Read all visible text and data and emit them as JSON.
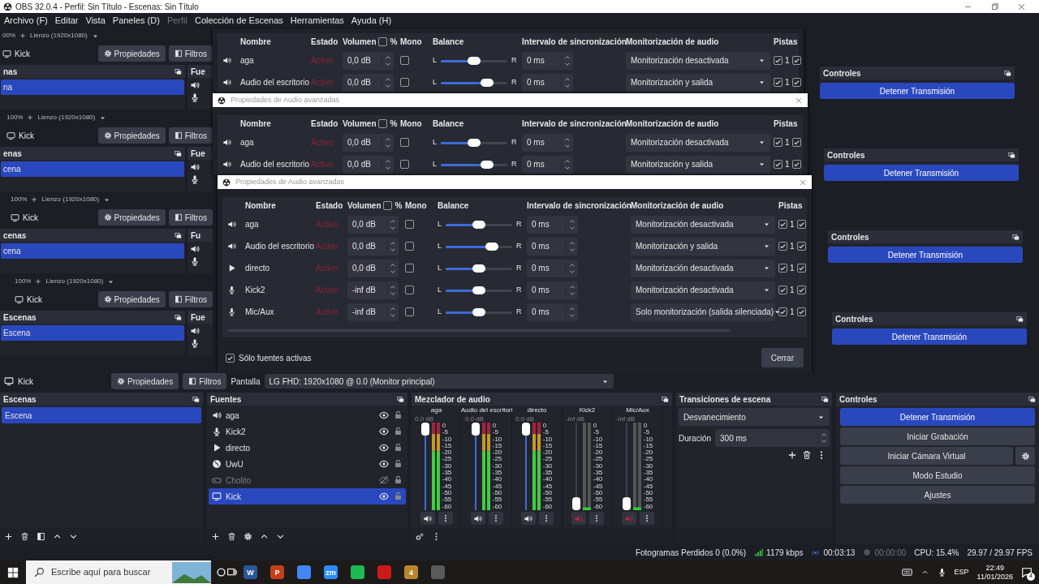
{
  "window": {
    "title": "OBS 32.0.4 - Perfil: Sin Título - Escenas: Sin Título"
  },
  "menu": [
    {
      "label": "Archivo (F)",
      "disabled": false
    },
    {
      "label": "Editar",
      "disabled": false
    },
    {
      "label": "Vista",
      "disabled": false
    },
    {
      "label": "Paneles (D)",
      "disabled": false
    },
    {
      "label": "Perfil",
      "disabled": true
    },
    {
      "label": "Colección de Escenas",
      "disabled": false
    },
    {
      "label": "Herramientas",
      "disabled": false
    },
    {
      "label": "Ayuda (H)",
      "disabled": false
    }
  ],
  "preview_layers": [
    {
      "zoom": "00%",
      "canvas": "Lienzo (1920x1080)",
      "source": "Kick",
      "properties": "Propiedades",
      "filters": "Filtros",
      "scenes_title": "nas",
      "sources_title": "Fue",
      "scene": "na",
      "controls_title": "Controles",
      "stream_button": "Detener Transmisión"
    },
    {
      "zoom": "100%",
      "canvas": "Lienzo (1920x1080)",
      "source": "Kick",
      "properties": "Propiedades",
      "filters": "Filtros",
      "scenes_title": "enas",
      "sources_title": "Fue",
      "scene": "cena",
      "controls_title": "Controles",
      "stream_button": "Detener Transmisión"
    },
    {
      "zoom": "100%",
      "canvas": "Lienzo (1920x1080)",
      "source": "Kick",
      "properties": "Propiedades",
      "filters": "Filtros",
      "scenes_title": "cenas",
      "sources_title": "Fu",
      "scene": "cena",
      "controls_title": "Controles",
      "stream_button": "Detener Transmisión"
    },
    {
      "zoom": "100%",
      "canvas": "Lienzo (1920x1080)",
      "source": "Kick",
      "properties": "Propiedades",
      "filters": "Filtros",
      "scenes_title": "Escenas",
      "sources_title": "Fue",
      "scene": "Escena",
      "controls_title": "Controles",
      "stream_button": "Detener Transmisión"
    }
  ],
  "dialogs": [
    {
      "columns": {
        "name": "Nombre",
        "status": "Estado",
        "volume": "Volumen",
        "percent": {
          "label": "%",
          "checked": false
        },
        "mono": "Mono",
        "balance": "Balance",
        "sync": "Intervalo de sincronización",
        "monitoring": "Monitorización de audio",
        "tracks": "Pistas"
      },
      "rows": [
        {
          "kind": "speaker",
          "name": "aga",
          "status": "Activo",
          "volume": "0,0 dB",
          "mono": false,
          "balance": {
            "left": "L",
            "right": "R",
            "level": 0.5
          },
          "sync": "0 ms",
          "monitoring": "Monitorización desactivada",
          "tracks": [
            {
              "label": "1",
              "checked": true
            },
            {
              "checked": true
            }
          ]
        },
        {
          "kind": "speaker",
          "name": "Audio del escritorio",
          "status": "Activo",
          "volume": "0,0 dB",
          "mono": false,
          "balance": {
            "left": "L",
            "right": "R",
            "level": 0.7
          },
          "sync": "0 ms",
          "monitoring": "Monitorización y salida",
          "tracks": [
            {
              "label": "1",
              "checked": true
            },
            {
              "checked": true
            }
          ]
        }
      ]
    },
    {
      "title": "Propiedades de Audio avanzadas",
      "columns": {
        "name": "Nombre",
        "status": "Estado",
        "volume": "Volumen",
        "percent": {
          "label": "%",
          "checked": false
        },
        "mono": "Mono",
        "balance": "Balance",
        "sync": "Intervalo de sincronización",
        "monitoring": "Monitorización de audio",
        "tracks": "Pistas"
      },
      "rows": [
        {
          "kind": "speaker",
          "name": "aga",
          "status": "Activo",
          "volume": "0,0 dB",
          "mono": false,
          "balance": {
            "left": "L",
            "right": "R",
            "level": 0.5
          },
          "sync": "0 ms",
          "monitoring": "Monitorización desactivada",
          "tracks": [
            {
              "label": "1",
              "checked": true
            },
            {
              "checked": true
            }
          ]
        },
        {
          "kind": "speaker",
          "name": "Audio del escritorio",
          "status": "Activo",
          "volume": "0,0 dB",
          "mono": false,
          "balance": {
            "left": "L",
            "right": "R",
            "level": 0.7
          },
          "sync": "0 ms",
          "monitoring": "Monitorización y salida",
          "tracks": [
            {
              "label": "1",
              "checked": true
            },
            {
              "checked": true
            }
          ]
        }
      ]
    },
    {
      "title": "Propiedades de Audio avanzadas",
      "columns": {
        "name": "Nombre",
        "status": "Estado",
        "volume": "Volumen",
        "percent": {
          "label": "%",
          "checked": false
        },
        "mono": "Mono",
        "balance": "Balance",
        "sync": "Intervalo de sincronización",
        "monitoring": "Monitorización de audio",
        "tracks": "Pistas"
      },
      "rows": [
        {
          "kind": "speaker",
          "name": "aga",
          "status": "Activo",
          "volume": "0,0 dB",
          "mono": false,
          "balance": {
            "left": "L",
            "right": "R",
            "level": 0.5
          },
          "sync": "0 ms",
          "monitoring": "Monitorización desactivada",
          "tracks": [
            {
              "label": "1",
              "checked": true
            },
            {
              "checked": true
            }
          ]
        },
        {
          "kind": "speaker",
          "name": "Audio del escritorio",
          "status": "Activo",
          "volume": "0,0 dB",
          "mono": false,
          "balance": {
            "left": "L",
            "right": "R",
            "level": 0.7
          },
          "sync": "0 ms",
          "monitoring": "Monitorización y salida",
          "tracks": [
            {
              "label": "1",
              "checked": true
            },
            {
              "checked": true
            }
          ]
        },
        {
          "kind": "media",
          "name": "directo",
          "status": "Activo",
          "volume": "0,0 dB",
          "mono": false,
          "balance": {
            "left": "L",
            "right": "R",
            "level": 0.5
          },
          "sync": "0 ms",
          "monitoring": "Monitorización desactivada",
          "tracks": [
            {
              "label": "1",
              "checked": true
            },
            {
              "checked": true
            }
          ]
        },
        {
          "kind": "mic",
          "name": "Kick2",
          "status": "Activo",
          "volume": "-inf dB",
          "mono": false,
          "balance": {
            "left": "L",
            "right": "R",
            "level": 0.5
          },
          "sync": "0 ms",
          "monitoring": "Monitorización desactivada",
          "tracks": [
            {
              "label": "1",
              "checked": true
            },
            {
              "checked": true
            }
          ]
        },
        {
          "kind": "mic",
          "name": "Mic/Aux",
          "status": "Activo",
          "volume": "-inf dB",
          "mono": false,
          "balance": {
            "left": "L",
            "right": "R",
            "level": 0.5
          },
          "sync": "0 ms",
          "monitoring": "Solo monitorización (salida silenciada)",
          "tracks": [
            {
              "label": "1",
              "checked": true
            },
            {
              "checked": true
            }
          ]
        }
      ],
      "active_only": {
        "label": "Sólo fuentes activas",
        "checked": true
      },
      "close_button": "Cerrar"
    }
  ],
  "source_toolbar": {
    "source": "Kick",
    "properties": "Propiedades",
    "filters": "Filtros",
    "display_label": "Pantalla",
    "display_value": "LG FHD: 1920x1080 @ 0.0 (Monitor principal)"
  },
  "scenes": {
    "title": "Escenas",
    "items": [
      {
        "label": "Escena",
        "selected": true
      }
    ]
  },
  "sources": {
    "title": "Fuentes",
    "items": [
      {
        "kind": "speaker",
        "label": "aga",
        "visible": true,
        "selected": false
      },
      {
        "kind": "mic",
        "label": "Kick2",
        "visible": true,
        "selected": false
      },
      {
        "kind": "media",
        "label": "directo",
        "visible": true,
        "selected": false
      },
      {
        "kind": "browser",
        "label": "UwU",
        "visible": true,
        "selected": false
      },
      {
        "kind": "game",
        "label": "Cholito",
        "visible": false,
        "selected": false
      },
      {
        "kind": "display",
        "label": "Kick",
        "visible": true,
        "selected": true
      }
    ]
  },
  "mixer": {
    "title": "Mezclador de audio",
    "channels": [
      {
        "name": "aga",
        "reading": "0.0 dB",
        "level": 1,
        "muted": false,
        "scale": [
          "0",
          "-5",
          "-10",
          "-15",
          "-20",
          "-25",
          "-30",
          "-35",
          "-40",
          "-45",
          "-50",
          "-55",
          "-60"
        ]
      },
      {
        "name": "Audio del escritori",
        "reading": "0.0 dB",
        "level": 1,
        "muted": false,
        "scale": [
          "0",
          "-5",
          "-10",
          "-15",
          "-20",
          "-25",
          "-30",
          "-35",
          "-40",
          "-45",
          "-50",
          "-55",
          "-60"
        ]
      },
      {
        "name": "directo",
        "reading": "0.0 dB",
        "level": 1,
        "muted": false,
        "scale": [
          "0",
          "-5",
          "-10",
          "-15",
          "-20",
          "-25",
          "-30",
          "-35",
          "-40",
          "-45",
          "-50",
          "-55",
          "-60"
        ]
      },
      {
        "name": "Kick2",
        "reading": "-inf dB",
        "level": 0,
        "muted": true,
        "scale": [
          "0",
          "-5",
          "-10",
          "-15",
          "-20",
          "-25",
          "-30",
          "-35",
          "-40",
          "-45",
          "-50",
          "-55",
          "-60"
        ]
      },
      {
        "name": "Mic/Aux",
        "reading": "-inf dB",
        "level": 0,
        "muted": true,
        "scale": [
          "0",
          "-5",
          "-10",
          "-15",
          "-20",
          "-25",
          "-30",
          "-35",
          "-40",
          "-45",
          "-50",
          "-55",
          "-60"
        ]
      }
    ]
  },
  "transitions": {
    "title": "Transiciones de escena",
    "transition": "Desvanecimiento",
    "duration_label": "Duración",
    "duration": "300 ms"
  },
  "controls": {
    "title": "Controles",
    "buttons": [
      {
        "label": "Detener Transmisión",
        "active": true,
        "settings": false
      },
      {
        "label": "Iniciar Grabación",
        "active": false,
        "settings": false
      },
      {
        "label": "Iniciar Cámara Virtual",
        "active": false,
        "settings": true
      },
      {
        "label": "Modo Estudio",
        "active": false,
        "settings": false
      },
      {
        "label": "Ajustes",
        "active": false,
        "settings": false
      }
    ]
  },
  "status_bar": {
    "dropped_frames": "Fotogramas Perdidos 0 (0.0%)",
    "bitrate": "1179 kbps",
    "stream_time": "00:03:13",
    "record_time": "00:00:00",
    "cpu": "CPU: 15.4%",
    "fps": "29.97 / 29.97 FPS"
  },
  "taskbar": {
    "search_placeholder": "Escribe aquí para buscar",
    "apps": [
      {
        "glyph": "W",
        "color": "#2b579a"
      },
      {
        "glyph": "P",
        "color": "#c43e1c"
      },
      {
        "color": "#4285f4"
      },
      {
        "glyph": "zm",
        "color": "#2d8cff"
      },
      {
        "color": "#1db954"
      },
      {
        "color": "#cc1a1a"
      },
      {
        "glyph": "4",
        "color": "#b8862b"
      },
      {
        "color": "#5a5a5a"
      }
    ],
    "language": "ESP",
    "time": "22:49",
    "date": "11/01/2026",
    "notifications": "4"
  }
}
